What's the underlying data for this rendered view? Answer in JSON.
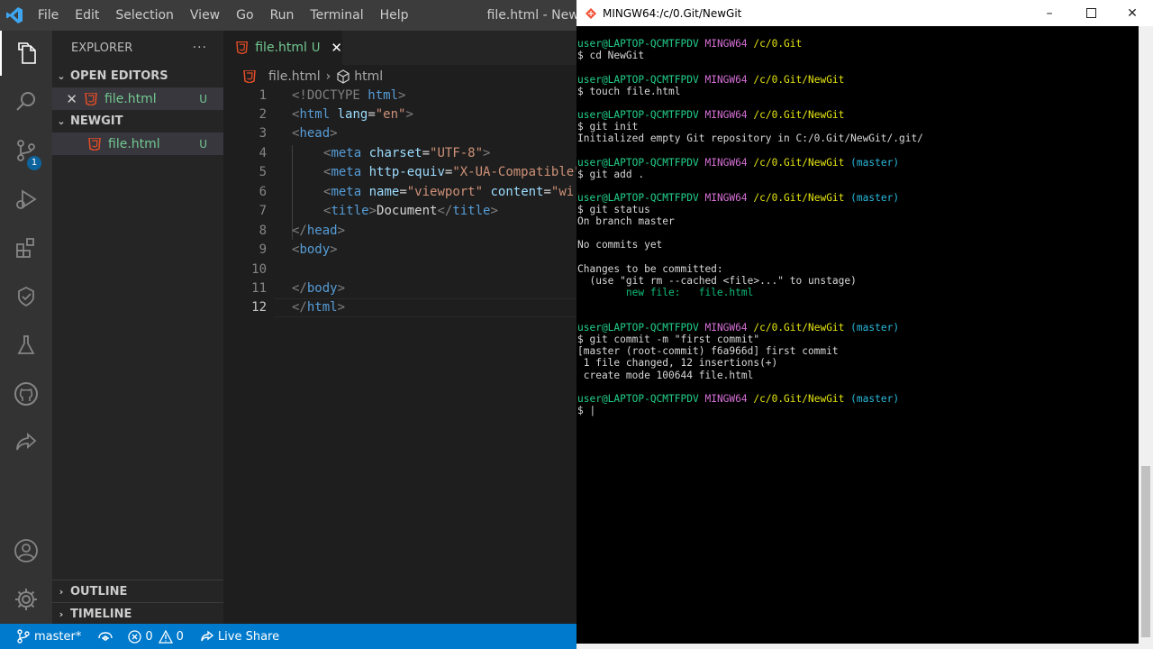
{
  "vscode": {
    "menu": [
      "File",
      "Edit",
      "Selection",
      "View",
      "Go",
      "Run",
      "Terminal",
      "Help"
    ],
    "window_title": "file.html - NewGit - Visual Studio Code",
    "sidebar": {
      "title": "EXPLORER",
      "more": "···",
      "open_editors_label": "OPEN EDITORS",
      "open_editor_file": "file.html",
      "open_editor_status": "U",
      "folder_label": "NEWGIT",
      "folder_file": "file.html",
      "folder_file_status": "U",
      "outline_label": "OUTLINE",
      "timeline_label": "TIMELINE"
    },
    "scm_badge": "1",
    "tab": {
      "label": "file.html",
      "status": "U"
    },
    "breadcrumb": {
      "file": "file.html",
      "symbol": "html"
    },
    "line_numbers": [
      "1",
      "2",
      "3",
      "4",
      "5",
      "6",
      "7",
      "8",
      "9",
      "10",
      "11",
      "12"
    ],
    "code": {
      "l1": [
        "<!DOCTYPE",
        " html",
        ">"
      ],
      "l2": [
        "<",
        "html",
        " lang",
        "=",
        "\"en\"",
        ">"
      ],
      "l3": [
        "<",
        "head",
        ">"
      ],
      "l4": [
        "<",
        "meta",
        " charset",
        "=",
        "\"UTF-8\"",
        ">"
      ],
      "l5": [
        "<",
        "meta",
        " http-equiv",
        "=",
        "\"X-UA-Compatible\""
      ],
      "l6": [
        "<",
        "meta",
        " name",
        "=",
        "\"viewport\"",
        " content",
        "=",
        "\"wi"
      ],
      "l7": [
        "<",
        "title",
        ">",
        "Document",
        "</",
        "title",
        ">"
      ],
      "l8": [
        "</",
        "head",
        ">"
      ],
      "l9": [
        "<",
        "body",
        ">"
      ],
      "l11": [
        "</",
        "body",
        ">"
      ],
      "l12": [
        "</",
        "html",
        ">"
      ]
    },
    "status": {
      "branch": "master*",
      "errors": "0",
      "warnings": "0",
      "live_share": "Live Share"
    }
  },
  "terminal": {
    "title": "MINGW64:/c/0.Git/NewGit",
    "prompt": {
      "user": "user@LAPTOP-QCMTFPDV",
      "env": "MINGW64",
      "branch": "(master)"
    },
    "path1": "/c/0.Git",
    "path2": "/c/0.Git/NewGit",
    "cmd1": "$ cd NewGit",
    "cmd2": "$ touch file.html",
    "cmd3": "$ git init",
    "out3": "Initialized empty Git repository in C:/0.Git/NewGit/.git/",
    "cmd4": "$ git add .",
    "cmd5": "$ git status",
    "out5a": "On branch master",
    "out5b": "No commits yet",
    "out5c": "Changes to be committed:",
    "out5d": "  (use \"git rm --cached <file>...\" to unstage)",
    "out5e": "        new file:   file.html",
    "cmd6": "$ git commit -m \"first commit\"",
    "out6a": "[master (root-commit) f6a966d] first commit",
    "out6b": " 1 file changed, 12 insertions(+)",
    "out6c": " create mode 100644 file.html",
    "cmd7": "$ |"
  }
}
